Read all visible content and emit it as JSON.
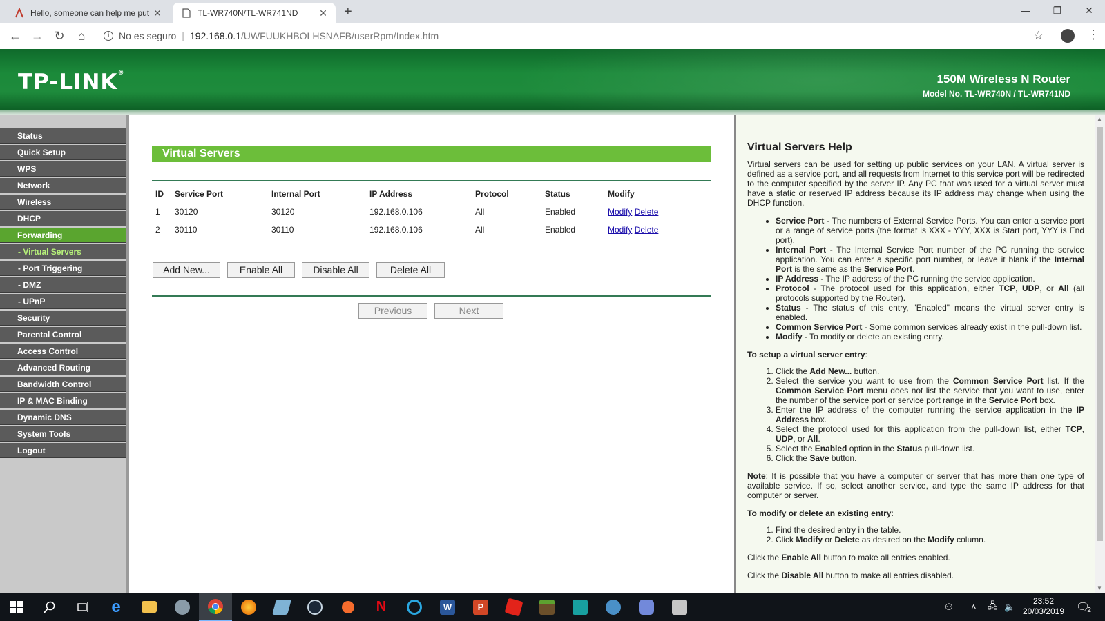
{
  "browser": {
    "tabs": [
      {
        "title": "Hello, someone can help me put"
      },
      {
        "title": "TL-WR740N/TL-WR741ND"
      }
    ],
    "new_tab": "+",
    "address": {
      "security_label": "No es seguro",
      "separator": "|",
      "host": "192.168.0.1",
      "path": "/UWFUUKHBOLHSNAFB/userRpm/Index.htm"
    }
  },
  "header": {
    "logo": "TP-LINK",
    "product_line1": "150M Wireless N Router",
    "product_line2": "Model No. TL-WR740N / TL-WR741ND",
    "brand_color": "#1e8b3c"
  },
  "sidebar": {
    "items": [
      {
        "label": "Status"
      },
      {
        "label": "Quick Setup"
      },
      {
        "label": "WPS"
      },
      {
        "label": "Network"
      },
      {
        "label": "Wireless"
      },
      {
        "label": "DHCP"
      },
      {
        "label": "Forwarding"
      },
      {
        "label": "- Virtual Servers"
      },
      {
        "label": "- Port Triggering"
      },
      {
        "label": "- DMZ"
      },
      {
        "label": "- UPnP"
      },
      {
        "label": "Security"
      },
      {
        "label": "Parental Control"
      },
      {
        "label": "Access Control"
      },
      {
        "label": "Advanced Routing"
      },
      {
        "label": "Bandwidth Control"
      },
      {
        "label": "IP & MAC Binding"
      },
      {
        "label": "Dynamic DNS"
      },
      {
        "label": "System Tools"
      },
      {
        "label": "Logout"
      }
    ]
  },
  "main": {
    "title": "Virtual Servers",
    "table": {
      "headers": [
        "ID",
        "Service Port",
        "Internal Port",
        "IP Address",
        "Protocol",
        "Status",
        "Modify"
      ],
      "rows": [
        {
          "id": "1",
          "service_port": "30120",
          "internal_port": "30120",
          "ip": "192.168.0.106",
          "protocol": "All",
          "status": "Enabled",
          "modify": "Modify",
          "delete": "Delete"
        },
        {
          "id": "2",
          "service_port": "30110",
          "internal_port": "30110",
          "ip": "192.168.0.106",
          "protocol": "All",
          "status": "Enabled",
          "modify": "Modify",
          "delete": "Delete"
        }
      ]
    },
    "buttons": {
      "add_new": "Add New...",
      "enable_all": "Enable All",
      "disable_all": "Disable All",
      "delete_all": "Delete All",
      "previous": "Previous",
      "next": "Next"
    }
  },
  "help": {
    "title": "Virtual Servers Help",
    "intro": "Virtual servers can be used for setting up public services on your LAN. A virtual server is defined as a service port, and all requests from Internet to this service port will be redirected to the computer specified by the server IP. Any PC that was used for a virtual server must have a static or reserved IP address because its IP address may change when using the DHCP function.",
    "bullets": [
      {
        "term": "Service Port",
        "text": " - The numbers of External Service Ports. You can enter a service port or a range of service ports (the format is XXX - YYY, XXX is Start port, YYY is End port)."
      },
      {
        "term": "Internal Port",
        "text": " - The Internal Service Port number of the PC running the service application. You can enter a specific port number, or leave it blank if the ",
        "term2": "Internal Port",
        "text2": " is the same as the ",
        "term3": "Service Port",
        "text3": "."
      },
      {
        "term": "IP Address",
        "text": " - The IP address of the PC running the service application."
      },
      {
        "term": "Protocol",
        "text": " - The protocol used for this application, either ",
        "term2": "TCP",
        "text2": ", ",
        "term3": "UDP",
        "text3": ", or ",
        "term4": "All",
        "text4": " (all protocols supported by the Router)."
      },
      {
        "term": "Status",
        "text": " - The status of this entry, \"Enabled\" means the virtual server entry is enabled."
      },
      {
        "term": "Common Service Port",
        "text": " - Some common services already exist in the pull-down list."
      },
      {
        "term": "Modify",
        "text": " - To modify or delete an existing entry."
      }
    ],
    "setup_heading": "To setup a virtual server entry",
    "setup_steps": {
      "s1a": "Click the ",
      "s1b": "Add New...",
      "s1c": " button.",
      "s2a": "Select the service you want to use from the ",
      "s2b": "Common Service Port",
      "s2c": " list. If the ",
      "s2d": "Common Service Port",
      "s2e": " menu does not list the service that you want to use, enter the number of the service port or service port range in the ",
      "s2f": "Service Port",
      "s2g": " box.",
      "s3a": "Enter the IP address of the computer running the service application in the ",
      "s3b": "IP Address",
      "s3c": " box.",
      "s4a": "Select the protocol used for this application from the pull-down list, either ",
      "s4b": "TCP",
      "s4c": ", ",
      "s4d": "UDP",
      "s4e": ", or ",
      "s4f": "All",
      "s4g": ".",
      "s5a": "Select the ",
      "s5b": "Enabled",
      "s5c": " option in the ",
      "s5d": "Status",
      "s5e": " pull-down list.",
      "s6a": "Click the ",
      "s6b": "Save",
      "s6c": " button."
    },
    "note_label": "Note",
    "note_text": ": It is possible that you have a computer or server that has more than one type of available service. If so, select another service, and type the same IP address for that computer or server.",
    "modify_heading": "To modify or delete an existing entry",
    "modify_steps": {
      "m1": "Find the desired entry in the table.",
      "m2a": "Click ",
      "m2b": "Modify",
      "m2c": " or ",
      "m2d": "Delete",
      "m2e": " as desired on the ",
      "m2f": "Modify",
      "m2g": " column."
    },
    "enable_all_a": "Click the ",
    "enable_all_b": "Enable All",
    "enable_all_c": " button to make all entries enabled.",
    "disable_all_a": "Click the ",
    "disable_all_b": "Disable All",
    "disable_all_c": " button to make all entries disabled."
  },
  "taskbar": {
    "time": "23:52",
    "date": "20/03/2019",
    "notifications": "2"
  }
}
